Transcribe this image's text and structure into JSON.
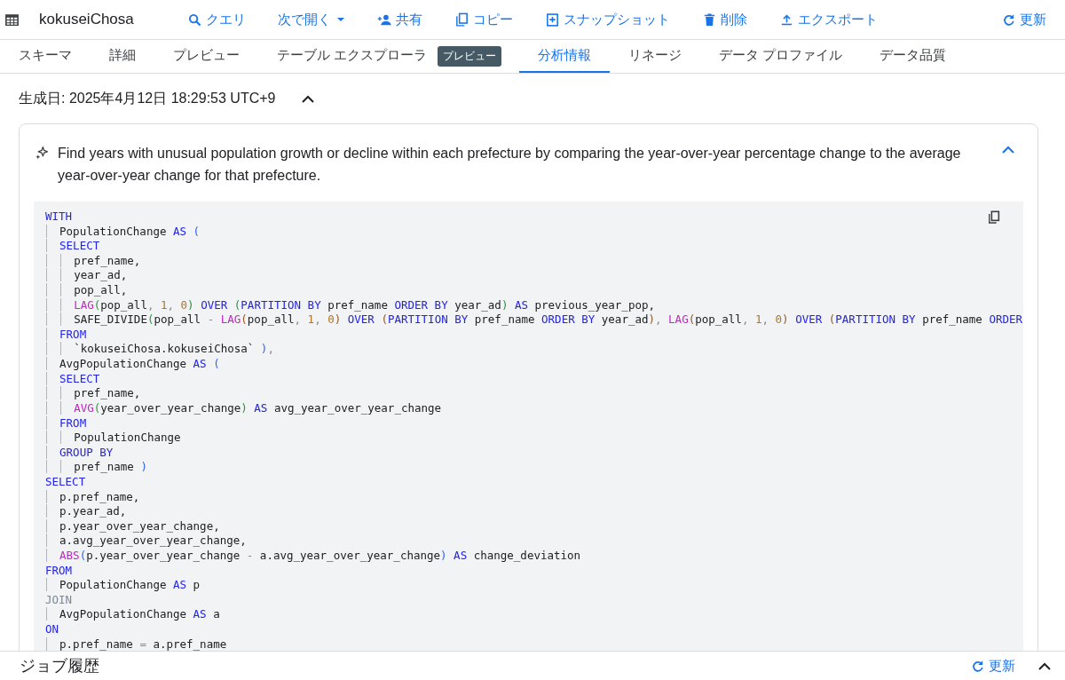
{
  "toolbar": {
    "title": "kokuseiChosa",
    "actions": [
      {
        "kind": "search",
        "label": "クエリ"
      },
      {
        "kind": "dropdown",
        "label": "次で開く"
      },
      {
        "kind": "share",
        "label": "共有"
      },
      {
        "kind": "copy",
        "label": "コピー"
      },
      {
        "kind": "snapshot",
        "label": "スナップショット"
      },
      {
        "kind": "delete",
        "label": "削除"
      },
      {
        "kind": "export",
        "label": "エクスポート"
      }
    ],
    "refresh": "更新"
  },
  "tabs": [
    {
      "label": "スキーマ",
      "selected": false
    },
    {
      "label": "詳細",
      "selected": false
    },
    {
      "label": "プレビュー",
      "selected": false
    },
    {
      "label": "テーブル エクスプローラ",
      "selected": false,
      "badge": "プレビュー"
    },
    {
      "label": "分析情報",
      "selected": true
    },
    {
      "label": "リネージ",
      "selected": false
    },
    {
      "label": "データ プロファイル",
      "selected": false
    },
    {
      "label": "データ品質",
      "selected": false
    }
  ],
  "insight": {
    "generated": "生成日: 2025年4月12日 18:29:53 UTC+9",
    "expanded": true,
    "description": "Find years with unusual population growth or decline within each prefecture by comparing the year-over-year percentage change to the average year-over-year change for that prefecture.",
    "code": [
      [
        {
          "kind": "kw",
          "text": "WITH"
        }
      ],
      [
        {
          "kind": "t",
          "text": "  PopulationChange "
        },
        {
          "kind": "kw",
          "text": "AS"
        },
        {
          "kind": "p1",
          "text": " ("
        }
      ],
      [
        {
          "kind": "kw",
          "text": "  SELECT"
        }
      ],
      [
        {
          "kind": "t",
          "text": "    pref_name,"
        }
      ],
      [
        {
          "kind": "t",
          "text": "    year_ad,"
        }
      ],
      [
        {
          "kind": "t",
          "text": "    pop_all,"
        }
      ],
      [
        {
          "kind": "fn",
          "text": "    LAG"
        },
        {
          "kind": "p2",
          "text": "("
        },
        {
          "kind": "t",
          "text": "pop_all"
        },
        {
          "kind": "op",
          "text": ", "
        },
        {
          "kind": "num",
          "text": "1"
        },
        {
          "kind": "op",
          "text": ", "
        },
        {
          "kind": "num",
          "text": "0"
        },
        {
          "kind": "p2",
          "text": ")"
        },
        {
          "kind": "kw",
          "text": " OVER"
        },
        {
          "kind": "p2",
          "text": " ("
        },
        {
          "kind": "kw",
          "text": "PARTITION BY"
        },
        {
          "kind": "t",
          "text": " pref_name "
        },
        {
          "kind": "kw",
          "text": "ORDER BY"
        },
        {
          "kind": "t",
          "text": " year_ad"
        },
        {
          "kind": "p2",
          "text": ")"
        },
        {
          "kind": "kw",
          "text": " AS"
        },
        {
          "kind": "t",
          "text": " previous_year_pop,"
        }
      ],
      [
        {
          "kind": "t",
          "text": "    SAFE_DIVIDE"
        },
        {
          "kind": "p2",
          "text": "("
        },
        {
          "kind": "t",
          "text": "pop_all "
        },
        {
          "kind": "op",
          "text": "-"
        },
        {
          "kind": "fn",
          "text": " LAG"
        },
        {
          "kind": "p3",
          "text": "("
        },
        {
          "kind": "t",
          "text": "pop_all"
        },
        {
          "kind": "op",
          "text": ", "
        },
        {
          "kind": "num",
          "text": "1"
        },
        {
          "kind": "op",
          "text": ", "
        },
        {
          "kind": "num",
          "text": "0"
        },
        {
          "kind": "p3",
          "text": ")"
        },
        {
          "kind": "kw",
          "text": " OVER"
        },
        {
          "kind": "p3",
          "text": " ("
        },
        {
          "kind": "kw",
          "text": "PARTITION BY"
        },
        {
          "kind": "t",
          "text": " pref_name "
        },
        {
          "kind": "kw",
          "text": "ORDER BY"
        },
        {
          "kind": "t",
          "text": " year_ad"
        },
        {
          "kind": "p3",
          "text": ")"
        },
        {
          "kind": "op",
          "text": ", "
        },
        {
          "kind": "fn",
          "text": "LAG"
        },
        {
          "kind": "p3",
          "text": "("
        },
        {
          "kind": "t",
          "text": "pop_all"
        },
        {
          "kind": "op",
          "text": ", "
        },
        {
          "kind": "num",
          "text": "1"
        },
        {
          "kind": "op",
          "text": ", "
        },
        {
          "kind": "num",
          "text": "0"
        },
        {
          "kind": "p3",
          "text": ")"
        },
        {
          "kind": "kw",
          "text": " OVER"
        },
        {
          "kind": "p3",
          "text": " ("
        },
        {
          "kind": "kw",
          "text": "PARTITION BY"
        },
        {
          "kind": "t",
          "text": " pref_name "
        },
        {
          "kind": "kw",
          "text": "ORDER"
        }
      ],
      [
        {
          "kind": "kw",
          "text": "  FROM"
        }
      ],
      [
        {
          "kind": "t",
          "text": "    `kokuseiChosa.kokuseiChosa` "
        },
        {
          "kind": "p1",
          "text": ")"
        },
        {
          "kind": "op",
          "text": ","
        }
      ],
      [
        {
          "kind": "t",
          "text": "  AvgPopulationChange "
        },
        {
          "kind": "kw",
          "text": "AS"
        },
        {
          "kind": "p1",
          "text": " ("
        }
      ],
      [
        {
          "kind": "kw",
          "text": "  SELECT"
        }
      ],
      [
        {
          "kind": "t",
          "text": "    pref_name,"
        }
      ],
      [
        {
          "kind": "fn",
          "text": "    AVG"
        },
        {
          "kind": "p2",
          "text": "("
        },
        {
          "kind": "t",
          "text": "year_over_year_change"
        },
        {
          "kind": "p2",
          "text": ")"
        },
        {
          "kind": "kw",
          "text": " AS"
        },
        {
          "kind": "t",
          "text": " avg_year_over_year_change"
        }
      ],
      [
        {
          "kind": "kw",
          "text": "  FROM"
        }
      ],
      [
        {
          "kind": "t",
          "text": "    PopulationChange"
        }
      ],
      [
        {
          "kind": "kw",
          "text": "  GROUP BY"
        }
      ],
      [
        {
          "kind": "t",
          "text": "    pref_name "
        },
        {
          "kind": "p1",
          "text": ")"
        }
      ],
      [
        {
          "kind": "kw",
          "text": "SELECT"
        }
      ],
      [
        {
          "kind": "t",
          "text": "  p.pref_name,"
        }
      ],
      [
        {
          "kind": "t",
          "text": "  p.year_ad,"
        }
      ],
      [
        {
          "kind": "t",
          "text": "  p.year_over_year_change,"
        }
      ],
      [
        {
          "kind": "t",
          "text": "  a.avg_year_over_year_change,"
        }
      ],
      [
        {
          "kind": "fn",
          "text": "  ABS"
        },
        {
          "kind": "p1",
          "text": "("
        },
        {
          "kind": "t",
          "text": "p.year_over_year_change "
        },
        {
          "kind": "op",
          "text": "-"
        },
        {
          "kind": "t",
          "text": " a.avg_year_over_year_change"
        },
        {
          "kind": "p1",
          "text": ")"
        },
        {
          "kind": "kw",
          "text": " AS"
        },
        {
          "kind": "t",
          "text": " change_deviation"
        }
      ],
      [
        {
          "kind": "kw",
          "text": "FROM"
        }
      ],
      [
        {
          "kind": "t",
          "text": "  PopulationChange "
        },
        {
          "kind": "kw",
          "text": "AS"
        },
        {
          "kind": "t",
          "text": " p"
        }
      ],
      [
        {
          "kind": "kw2",
          "text": "JOIN"
        }
      ],
      [
        {
          "kind": "t",
          "text": "  AvgPopulationChange "
        },
        {
          "kind": "kw",
          "text": "AS"
        },
        {
          "kind": "t",
          "text": " a"
        }
      ],
      [
        {
          "kind": "kw",
          "text": "ON"
        }
      ],
      [
        {
          "kind": "t",
          "text": "  p.pref_name "
        },
        {
          "kind": "op",
          "text": "="
        },
        {
          "kind": "t",
          "text": " a.pref_name"
        }
      ]
    ]
  },
  "job_history": {
    "title": "ジョブ履歴",
    "refresh": "更新"
  }
}
